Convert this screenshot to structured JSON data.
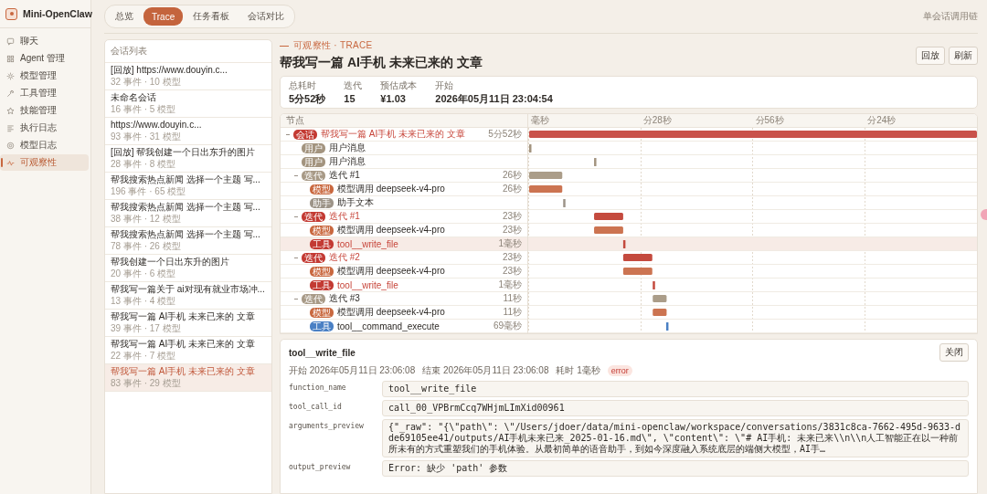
{
  "app": {
    "name": "Mini-OpenClaw"
  },
  "sidebar": {
    "items": [
      {
        "label": "聊天",
        "selected": false
      },
      {
        "label": "Agent 管理",
        "selected": false
      },
      {
        "label": "模型管理",
        "selected": false
      },
      {
        "label": "工具管理",
        "selected": false
      },
      {
        "label": "技能管理",
        "selected": false
      },
      {
        "label": "执行日志",
        "selected": false
      },
      {
        "label": "模型日志",
        "selected": false
      },
      {
        "label": "可观察性",
        "selected": true
      }
    ]
  },
  "tabs": [
    {
      "label": "总览",
      "selected": false
    },
    {
      "label": "Trace",
      "selected": true
    },
    {
      "label": "任务看板",
      "selected": false
    },
    {
      "label": "会话对比",
      "selected": false
    }
  ],
  "top_right_label": "单会话调用链",
  "conversations": {
    "title": "会话列表",
    "items": [
      {
        "title": "[回放] https://www.douyin.c...",
        "meta": "32 事件 · 10 模型",
        "selected": false
      },
      {
        "title": "未命名会话",
        "meta": "16 事件 · 5 模型",
        "selected": false
      },
      {
        "title": "https://www.douyin.c...",
        "meta": "93 事件 · 31 模型",
        "selected": false
      },
      {
        "title": "[回放] 帮我创建一个日出东升的图片",
        "meta": "28 事件 · 8 模型",
        "selected": false
      },
      {
        "title": "帮我搜索热点新闻 选择一个主题 写...",
        "meta": "196 事件 · 65 模型",
        "selected": false
      },
      {
        "title": "帮我搜索热点新闻 选择一个主题 写...",
        "meta": "38 事件 · 12 模型",
        "selected": false
      },
      {
        "title": "帮我搜索热点新闻 选择一个主题 写...",
        "meta": "78 事件 · 26 模型",
        "selected": false
      },
      {
        "title": "帮我创建一个日出东升的图片",
        "meta": "20 事件 · 6 模型",
        "selected": false
      },
      {
        "title": "帮我写一篇关于 ai对现有就业市场冲...",
        "meta": "13 事件 · 4 模型",
        "selected": false
      },
      {
        "title": "帮我写一篇 AI手机 未来已来的 文章",
        "meta": "39 事件 · 17 模型",
        "selected": false
      },
      {
        "title": "帮我写一篇 AI手机 未来已来的 文章",
        "meta": "22 事件 · 7 模型",
        "selected": false
      },
      {
        "title": "帮我写一篇 AI手机 未来已来的 文章",
        "meta": "83 事件 · 29 模型",
        "selected": true
      }
    ]
  },
  "header": {
    "eyebrow": "可观察性 · TRACE",
    "title": "帮我写一篇 AI手机 未来已来的 文章",
    "buttons": [
      "回放",
      "刷新"
    ]
  },
  "stats": [
    {
      "label": "总耗时",
      "value": "5分52秒"
    },
    {
      "label": "迭代",
      "value": "15"
    },
    {
      "label": "预估成本",
      "value": "¥1.03"
    },
    {
      "label": "开始",
      "value": "2026年05月11日 23:04:54"
    }
  ],
  "trace": {
    "column_label": "节点",
    "ticks": [
      "毫秒",
      "分28秒",
      "分56秒",
      "分24秒"
    ],
    "nodes": [
      {
        "kind": "session",
        "tag": "会话",
        "label": "帮我写一篇 AI手机 未来已来的 文章",
        "duration": "5分52秒",
        "error": true,
        "expanded": true,
        "selected": false,
        "children": [
          {
            "kind": "user",
            "tag": "用户",
            "label": "用户消息",
            "error": false,
            "selected": false
          },
          {
            "kind": "user",
            "tag": "用户",
            "label": "用户消息",
            "error": false,
            "selected": false
          },
          {
            "kind": "iteration",
            "tag": "迭代",
            "label": "迭代 #1",
            "duration": "26秒",
            "error": false,
            "expanded": true,
            "selected": false,
            "children": [
              {
                "kind": "model",
                "tag": "模型",
                "label": "模型调用 deepseek-v4-pro",
                "duration": "26秒",
                "error": false,
                "selected": false
              },
              {
                "kind": "assistant",
                "tag": "助手",
                "label": "助手文本",
                "error": false,
                "selected": false
              }
            ]
          },
          {
            "kind": "iteration",
            "tag": "迭代",
            "label": "迭代 #1",
            "duration": "23秒",
            "error": true,
            "expanded": true,
            "selected": false,
            "children": [
              {
                "kind": "model",
                "tag": "模型",
                "label": "模型调用 deepseek-v4-pro",
                "duration": "23秒",
                "error": false,
                "selected": false
              },
              {
                "kind": "tool",
                "tag": "工具",
                "label": "tool__write_file",
                "duration": "1毫秒",
                "error": true,
                "selected": true
              }
            ]
          },
          {
            "kind": "iteration",
            "tag": "迭代",
            "label": "迭代 #2",
            "duration": "23秒",
            "error": true,
            "expanded": true,
            "selected": false,
            "children": [
              {
                "kind": "model",
                "tag": "模型",
                "label": "模型调用 deepseek-v4-pro",
                "duration": "23秒",
                "error": false,
                "selected": false
              },
              {
                "kind": "tool",
                "tag": "工具",
                "label": "tool__write_file",
                "duration": "1毫秒",
                "error": true,
                "selected": false
              }
            ]
          },
          {
            "kind": "iteration",
            "tag": "迭代",
            "label": "迭代 #3",
            "duration": "11秒",
            "error": false,
            "expanded": true,
            "selected": false,
            "children": [
              {
                "kind": "model",
                "tag": "模型",
                "label": "模型调用 deepseek-v4-pro",
                "duration": "11秒",
                "error": false,
                "selected": false
              },
              {
                "kind": "tool",
                "tag": "工具",
                "label": "tool__command_execute",
                "duration": "69毫秒",
                "error": false,
                "selected": false
              }
            ]
          }
        ]
      }
    ]
  },
  "detail": {
    "title": "tool__write_file",
    "close": "关闭",
    "start": "开始 2026年05月11日 23:06:08",
    "end": "结束 2026年05月11日 23:06:08",
    "elapsed": "耗时 1毫秒",
    "status": "error",
    "fields": [
      {
        "name": "function_name",
        "value": "tool__write_file"
      },
      {
        "name": "tool_call_id",
        "value": "call_00_VPBrmCcq7WHjmLImXid00961"
      },
      {
        "name": "arguments_preview",
        "value": "{\"_raw\": \"{\\\"path\\\": \\\"/Users/jdoer/data/mini-openclaw/workspace/conversations/3831c8ca-7662-495d-9633-dde69105ee41/outputs/AI手机未来已来_2025-01-16.md\\\", \\\"content\\\": \\\"# AI手机: 未来已来\\\\n\\\\n人工智能正在以一种前所未有的方式重塑我们的手机体验。从最初简单的语音助手，到如今深度融入系统底层的端侧大模型，AI手…"
      },
      {
        "name": "output_preview",
        "value": "Error: 缺少 'path' 参数"
      }
    ]
  }
}
